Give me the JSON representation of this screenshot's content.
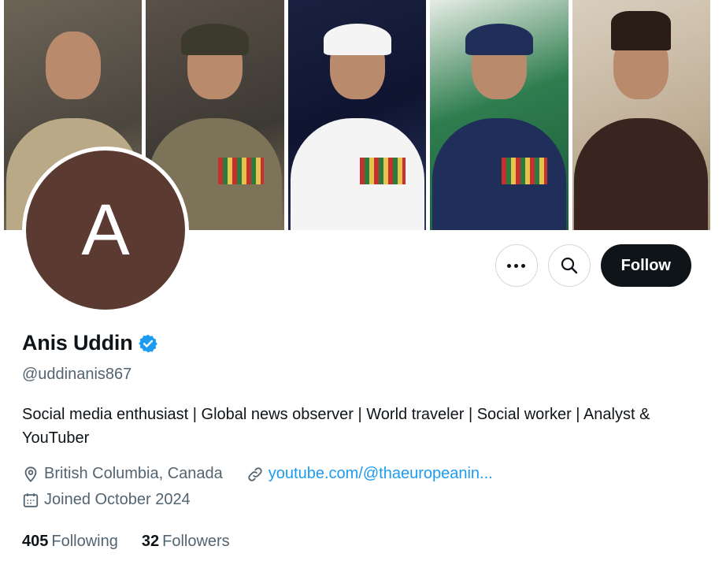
{
  "banner": {
    "portraits": [
      "portrait-1",
      "portrait-2",
      "portrait-3",
      "portrait-4",
      "portrait-5"
    ]
  },
  "avatar": {
    "letter": "A",
    "color": "#5b3a31"
  },
  "actions": {
    "more_icon": "more-dots-icon",
    "search_icon": "search-icon",
    "follow_label": "Follow"
  },
  "profile": {
    "name": "Anis Uddin",
    "verified_icon": "verified-badge-icon",
    "handle": "@uddinanis867",
    "bio": "Social media enthusiast | Global news observer | World traveler | Social worker | Analyst & YouTuber",
    "location": "British Columbia, Canada",
    "link": "youtube.com/@thaeuropeanin...",
    "joined": "Joined October 2024"
  },
  "stats": {
    "following_count": "405",
    "following_label": "Following",
    "followers_count": "32",
    "followers_label": "Followers"
  },
  "colors": {
    "accent": "#1d9bf0",
    "text": "#0f1419",
    "muted": "#536471"
  }
}
